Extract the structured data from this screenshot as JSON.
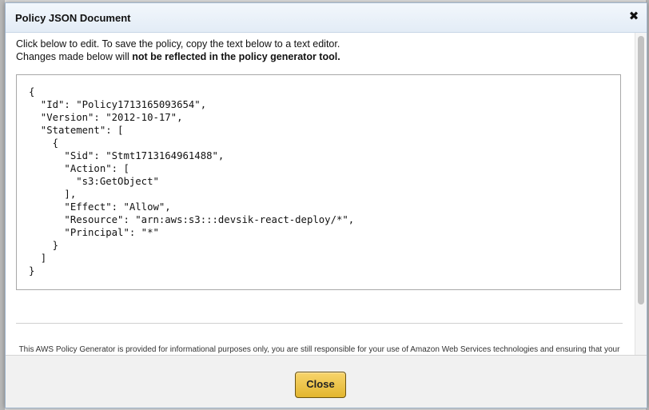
{
  "dialog": {
    "title": "Policy JSON Document",
    "close_icon": "close-icon",
    "intro_line1": "Click below to edit. To save the policy, copy the text below to a text editor.",
    "intro_line2_prefix": "Changes made below will ",
    "intro_line2_bold": "not be reflected in the policy generator tool.",
    "policy_text": "{\n  \"Id\": \"Policy1713165093654\",\n  \"Version\": \"2012-10-17\",\n  \"Statement\": [\n    {\n      \"Sid\": \"Stmt1713164961488\",\n      \"Action\": [\n        \"s3:GetObject\"\n      ],\n      \"Effect\": \"Allow\",\n      \"Resource\": \"arn:aws:s3:::devsik-react-deploy/*\",\n      \"Principal\": \"*\"\n    }\n  ]\n}",
    "disclaimer": "This AWS Policy Generator is provided for informational purposes only, you are still responsible for your use of Amazon Web Services technologies and ensuring that your use is in compliance with all applicable terms and conditions. This AWS Policy Generator is provided as is without warranty of any kind, whether",
    "close_button_label": "Close"
  },
  "colors": {
    "button_accent": "#e9bf3e",
    "titlebar": "#e3ecf6"
  }
}
